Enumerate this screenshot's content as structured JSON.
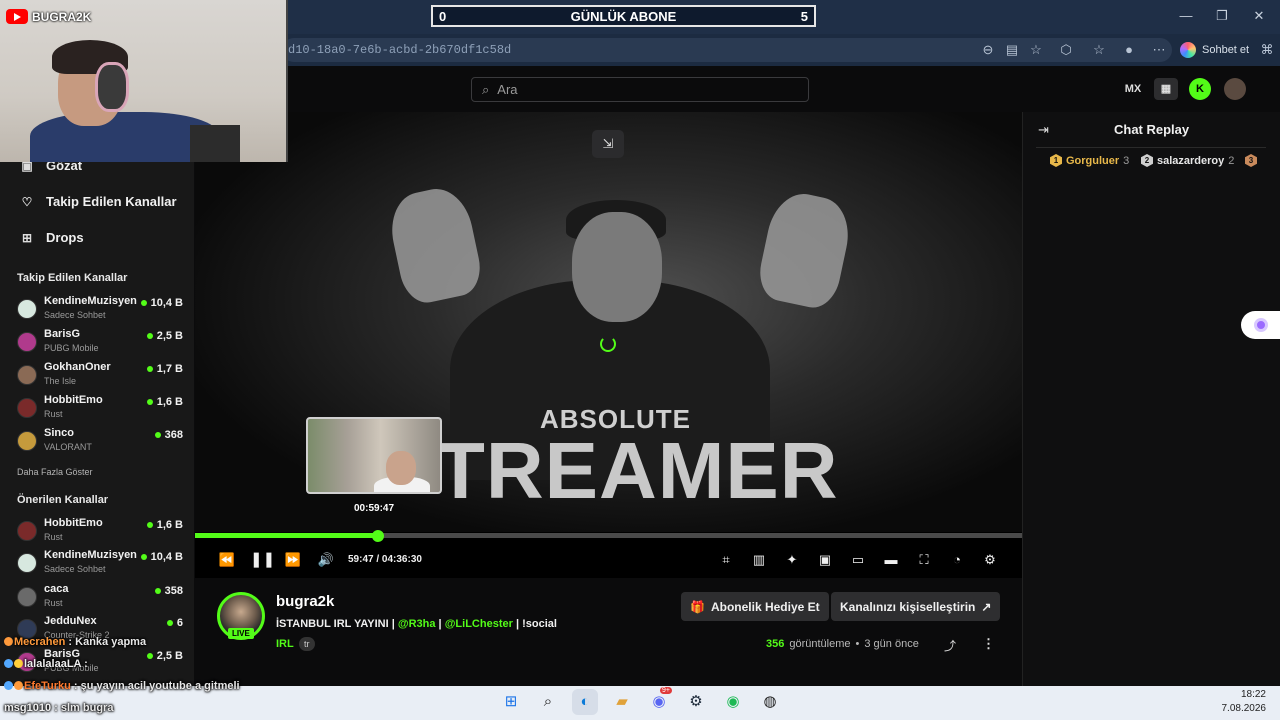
{
  "browser": {
    "url_fragment": "d10-18a0-7e6b-acbd-2b670df1c58d",
    "copilot_label": "Sohbet et",
    "window_controls": [
      "minimize-icon",
      "restore-icon",
      "close-icon"
    ]
  },
  "overlay": {
    "sub_counter": {
      "left": "0",
      "title": "GÜNLÜK ABONE",
      "right": "5"
    },
    "yt_channel": "BUGRA2K",
    "chat": [
      {
        "user": "Mecrahen",
        "sep": " : ",
        "msg": "Kanka yapma",
        "user_color": "#ff9a3c",
        "msg_color": "#ffffff"
      },
      {
        "user": "lalalalaaLA",
        "sep": " : ",
        "msg": "",
        "user_color": "#f0f0f0",
        "msg_color": "#ffffff"
      },
      {
        "user": "EfeTurku",
        "sep": " : ",
        "msg": "şu yayın acil youtube a gitmeli",
        "user_color": "#ff7a2e",
        "msg_color": "#ffffff"
      },
      {
        "user": "msg1010",
        "sep": " : ",
        "msg": "slm bugra",
        "user_color": "#f0f0f0",
        "msg_color": "#ffffff"
      }
    ]
  },
  "header": {
    "search_placeholder": "Ara",
    "icons": [
      "mx-icon",
      "layout-icon",
      "kick-icon",
      "profile-avatar"
    ],
    "accent": "#53fc18"
  },
  "sidebar": {
    "nav": [
      {
        "label": "Gözat",
        "icon": "browse-icon"
      },
      {
        "label": "Takip Edilen Kanallar",
        "icon": "heart-icon"
      },
      {
        "label": "Drops",
        "icon": "drops-icon"
      }
    ],
    "followed_title": "Takip Edilen Kanallar",
    "followed": [
      {
        "name": "KendineMuzisyen",
        "game": "Sadece Sohbet",
        "viewers": "10,4 B"
      },
      {
        "name": "BarisG",
        "game": "PUBG Mobile",
        "viewers": "2,5 B"
      },
      {
        "name": "GokhanOner",
        "game": "The Isle",
        "viewers": "1,7 B"
      },
      {
        "name": "HobbitEmo",
        "game": "Rust",
        "viewers": "1,6 B"
      },
      {
        "name": "Sinco",
        "game": "VALORANT",
        "viewers": "368"
      }
    ],
    "show_more": "Daha Fazla Göster",
    "recommended_title": "Önerilen Kanallar",
    "recommended": [
      {
        "name": "HobbitEmo",
        "game": "Rust",
        "viewers": "1,6 B"
      },
      {
        "name": "KendineMuzisyen",
        "game": "Sadece Sohbet",
        "viewers": "10,4 B"
      },
      {
        "name": "caca",
        "game": "Rust",
        "viewers": "358"
      },
      {
        "name": "JedduNex",
        "game": "Counter-Strike 2",
        "viewers": "6"
      },
      {
        "name": "BarisG",
        "game": "PUBG Mobile",
        "viewers": "2,5 B"
      }
    ]
  },
  "player": {
    "thumbnail_title_small": "ABSOLUTE",
    "thumbnail_title_big": "TREAMER",
    "preview_time": "00:59:47",
    "current_time": "59:47",
    "time_sep": "/",
    "duration": "04:36:30",
    "progress_fraction": 0.2216,
    "controls_left": [
      "rewind-icon",
      "pause-icon",
      "forward-icon",
      "volume-icon"
    ],
    "controls_right": [
      "clip-icon",
      "stats-icon",
      "sparkle-icon",
      "pip-icon",
      "cast-icon",
      "theater-icon",
      "fullscreen-icon",
      "speed-icon",
      "settings-icon"
    ]
  },
  "stream": {
    "name": "bugra2k",
    "live": "LIVE",
    "title_parts": [
      {
        "text": "İSTANBUL  IRL YAYINI | ",
        "green": false
      },
      {
        "text": "@R3ha",
        "green": true
      },
      {
        "text": " | ",
        "green": false
      },
      {
        "text": "@LiLChester",
        "green": true
      },
      {
        "text": " | !social",
        "green": false
      }
    ],
    "category": "IRL",
    "language": "tr",
    "gift_button": "Abonelik Hediye Et",
    "customize_button": "Kanalınızı kişiselleştirin",
    "views_num": "356",
    "views_label": "görüntüleme",
    "bullet": "•",
    "ago": "3 gün önce"
  },
  "chat_panel": {
    "title": "Chat Replay",
    "gifters": [
      {
        "rank": "1",
        "name": "Gorguluer",
        "count": "3",
        "color": "#e8b84a",
        "name_color": "#e8b84a"
      },
      {
        "rank": "2",
        "name": "salazarderoy",
        "count": "2",
        "color": "#cfcfcf",
        "name_color": "#e6e6e6"
      },
      {
        "rank": "3",
        "name": "",
        "count": "",
        "color": "#c98a5c",
        "name_color": "#c98a5c"
      }
    ]
  },
  "taskbar": {
    "apps": [
      "windows-start-icon",
      "search-icon",
      "edge-icon",
      "files-icon",
      "discord-icon",
      "steam-icon",
      "spotify-icon",
      "obs-icon"
    ],
    "discord_badge": "9+",
    "time": "18:22",
    "date": "7.08.2026"
  }
}
